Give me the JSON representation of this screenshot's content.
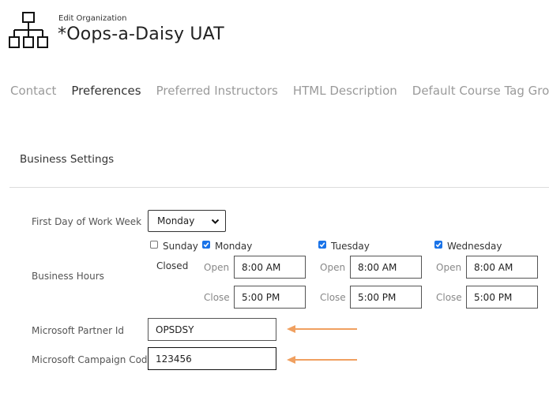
{
  "header": {
    "subtitle": "Edit Organization",
    "title": "*Oops-a-Daisy UAT",
    "icon": "org-chart-icon"
  },
  "tabs": [
    {
      "label": "Contact",
      "active": false
    },
    {
      "label": "Preferences",
      "active": true
    },
    {
      "label": "Preferred Instructors",
      "active": false
    },
    {
      "label": "HTML Description",
      "active": false
    },
    {
      "label": "Default Course Tag Groups",
      "active": false
    }
  ],
  "section_title": "Business Settings",
  "form": {
    "first_day_label": "First Day of Work Week",
    "first_day_value": "Monday",
    "business_hours_label": "Business Hours",
    "days": [
      {
        "name": "Sunday",
        "checked": false,
        "closed_label": "Closed"
      },
      {
        "name": "Monday",
        "checked": true,
        "open_label": "Open",
        "open": "8:00 AM",
        "close_label": "Close",
        "close": "5:00 PM"
      },
      {
        "name": "Tuesday",
        "checked": true,
        "open_label": "Open",
        "open": "8:00 AM",
        "close_label": "Close",
        "close": "5:00 PM"
      },
      {
        "name": "Wednesday",
        "checked": true,
        "open_label": "Open",
        "open": "8:00 AM",
        "close_label": "Close",
        "close": "5:00 PM"
      }
    ],
    "partner_id_label": "Microsoft Partner Id",
    "partner_id_value": "OPSDSY",
    "campaign_code_label": "Microsoft Campaign Code",
    "campaign_code_value": "123456"
  },
  "colors": {
    "accent": "#1a73e8",
    "annotation_arrow": "#f0a060"
  }
}
